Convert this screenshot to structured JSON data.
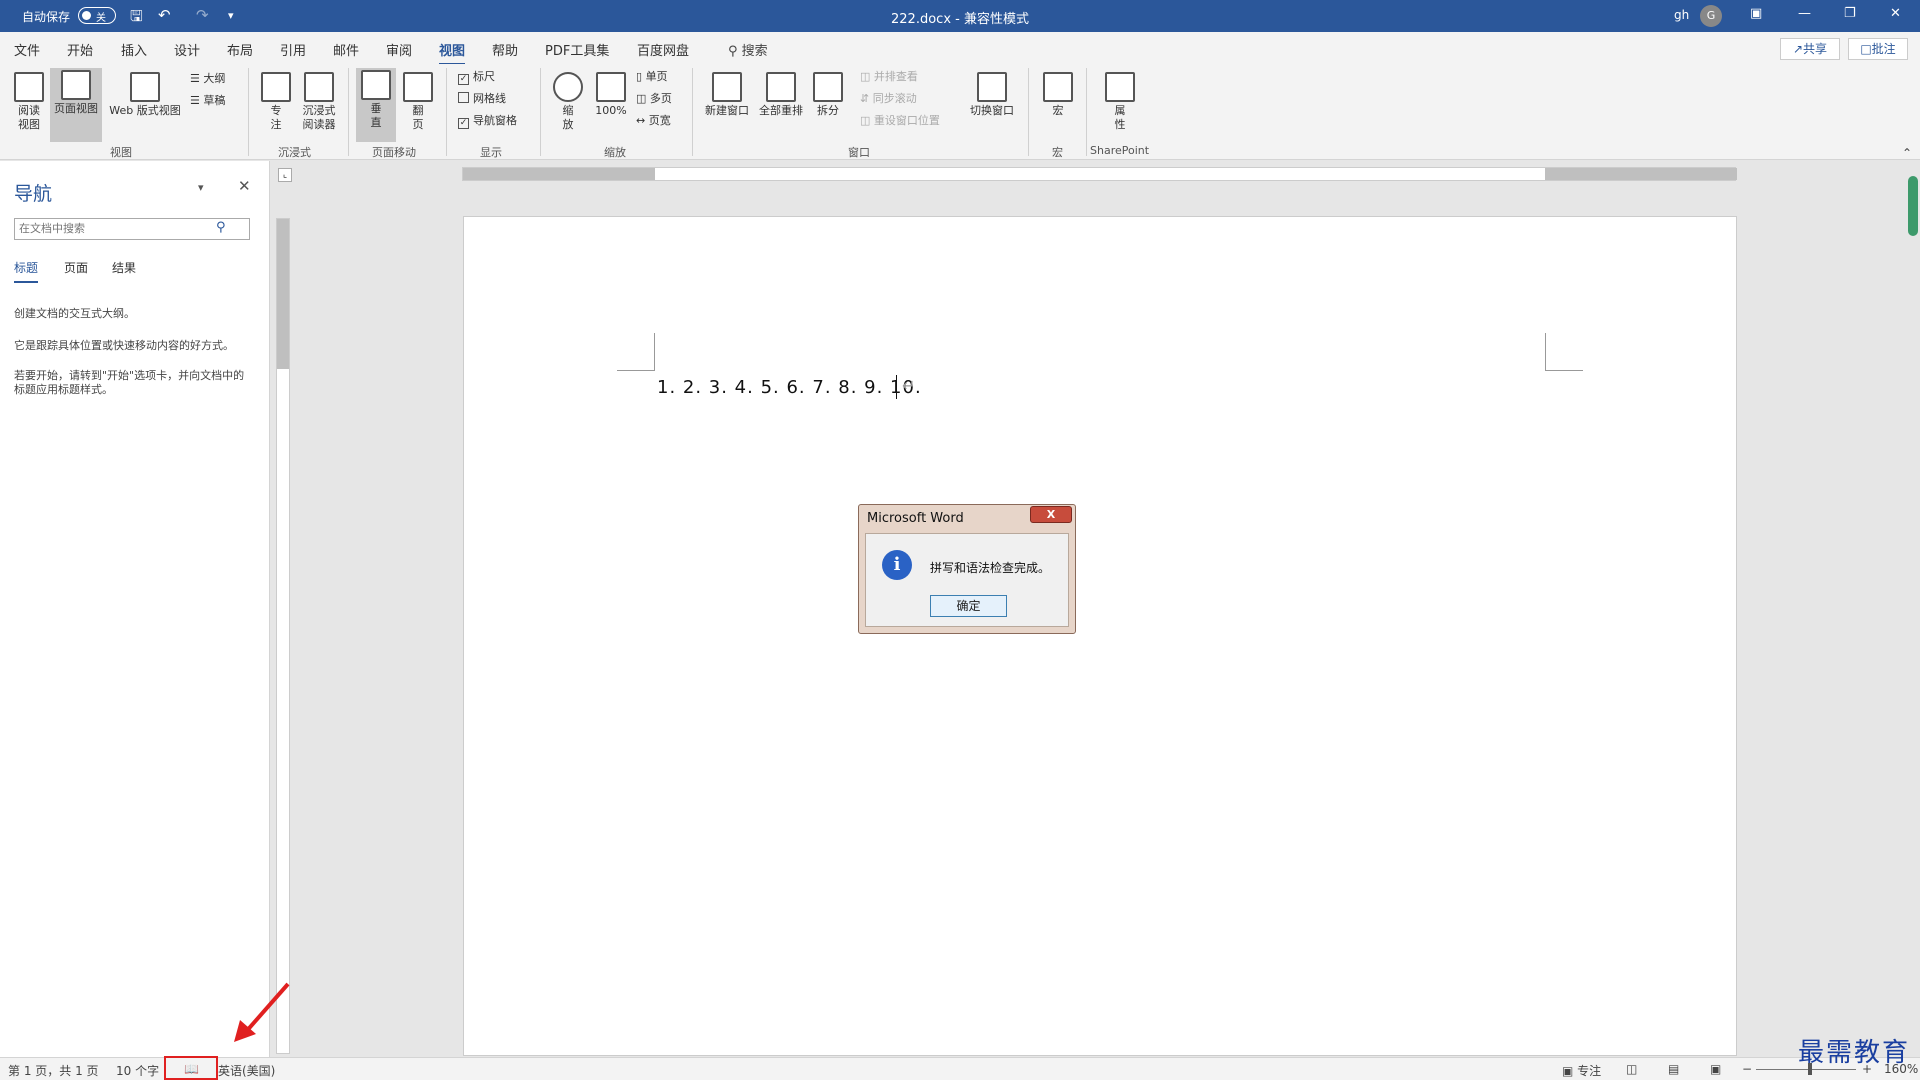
{
  "titlebar": {
    "autosave": "自动保存",
    "toggle": "关",
    "doc_title": "222.docx  -  兼容性模式",
    "user": "gh",
    "avatar": "G"
  },
  "menu": {
    "tabs": [
      "文件",
      "开始",
      "插入",
      "设计",
      "布局",
      "引用",
      "邮件",
      "审阅",
      "视图",
      "帮助",
      "PDF工具集",
      "百度网盘"
    ],
    "search": "搜索",
    "share": "共享",
    "comments": "批注"
  },
  "ribbon": {
    "views": {
      "read": "阅读\n视图",
      "print": "页面视图",
      "web": "Web 版式视图",
      "outline": "大纲",
      "draft": "草稿",
      "label": "视图"
    },
    "immersive": {
      "focus": "专\n注",
      "reader": "沉浸式\n阅读器",
      "label": "沉浸式"
    },
    "pagemove": {
      "vertical": "垂\n直",
      "side": "翻\n页",
      "label": "页面移动"
    },
    "show": {
      "ruler": "标尺",
      "grid": "网格线",
      "nav": "导航窗格",
      "label": "显示"
    },
    "zoom": {
      "zoom": "缩\n放",
      "pct": "100%",
      "one": "单页",
      "multi": "多页",
      "width": "页宽",
      "label": "缩放"
    },
    "window": {
      "new": "新建窗口",
      "arrange": "全部重排",
      "split": "拆分",
      "side": "并排查看",
      "sync": "同步滚动",
      "reset": "重设窗口位置",
      "switch": "切换窗口",
      "label": "窗口"
    },
    "macros": {
      "macro": "宏",
      "label": "宏"
    },
    "sharepoint": {
      "prop": "属\n性",
      "label": "SharePoint"
    }
  },
  "nav": {
    "title": "导航",
    "search_placeholder": "在文档中搜索",
    "tabs": [
      "标题",
      "页面",
      "结果"
    ],
    "text1": "创建文档的交互式大纲。",
    "text2": "它是跟踪具体位置或快速移动内容的好方式。",
    "text3": "若要开始，请转到\"开始\"选项卡，并向文档中的标题应用标题样式。"
  },
  "document": {
    "text": "1. 2. 3. 4. 5. 6. 7. 8. 9. 10."
  },
  "dialog": {
    "title": "Microsoft Word",
    "message": "拼写和语法检查完成。",
    "ok": "确定",
    "close": "X"
  },
  "status": {
    "page": "第 1 页，共 1 页",
    "words": "10 个字",
    "language": "英语(美国)",
    "focus": "专注",
    "zoom": "160%"
  },
  "watermark": "最需教育"
}
